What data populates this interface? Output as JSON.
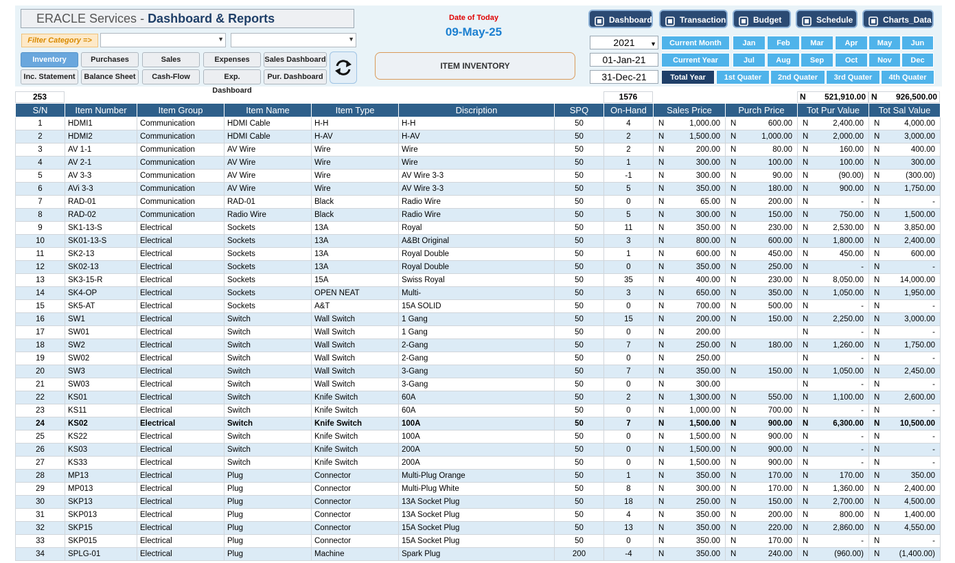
{
  "header": {
    "title_part1": "ERACLE Services",
    "title_sep": " - ",
    "title_part2": "Dashboard & Reports",
    "filter_label": "Filter Category =>",
    "date_label": "Date of Today",
    "date_value": "09-May-25",
    "item_inventory": "ITEM INVENTORY",
    "year": "2021",
    "start_date": "01-Jan-21",
    "end_date": "31-Dec-21"
  },
  "nav": {
    "row1": [
      "Inventory",
      "Purchases",
      "Sales",
      "Expenses",
      "Sales Dashboard"
    ],
    "row2": [
      "Inc. Statement",
      "Balance Sheet",
      "Cash-Flow",
      "Exp. Dashboard",
      "Pur. Dashboard"
    ]
  },
  "top_buttons": [
    "Dashboard",
    "Transaction",
    "Budget",
    "Schedule",
    "Charts_Data"
  ],
  "periods": {
    "row1": [
      "Current Month",
      "Jan",
      "Feb",
      "Mar",
      "Apr",
      "May",
      "Jun"
    ],
    "row2": [
      "Current Year",
      "Jul",
      "Aug",
      "Sep",
      "Oct",
      "Nov",
      "Dec"
    ],
    "row3": [
      "Total Year",
      "1st Quater",
      "2nd Quater",
      "3rd Quater",
      "4th Quater"
    ]
  },
  "summary": {
    "count": "253",
    "on_hand_total": "1576",
    "currency": "N",
    "tot_pur": "521,910.00",
    "tot_sal": "926,500.00"
  },
  "columns": [
    "S/N",
    "Item Number",
    "Item Group",
    "Item Name",
    "Item Type",
    "Discription",
    "SPQ",
    "On-Hand",
    "Sales Price",
    "Purch Price",
    "Tot Pur Value",
    "Tot Sal Value"
  ],
  "rows": [
    [
      "1",
      "HDMI1",
      "Communication",
      "HDMI Cable",
      "H-H",
      "H-H",
      "50",
      "4",
      "N",
      "1,000.00",
      "N",
      "600.00",
      "N",
      "2,400.00",
      "N",
      "4,000.00"
    ],
    [
      "2",
      "HDMI2",
      "Communication",
      "HDMI Cable",
      "H-AV",
      "H-AV",
      "50",
      "2",
      "N",
      "1,500.00",
      "N",
      "1,000.00",
      "N",
      "2,000.00",
      "N",
      "3,000.00"
    ],
    [
      "3",
      "AV  1-1",
      "Communication",
      "AV Wire",
      "Wire",
      "Wire",
      "50",
      "2",
      "N",
      "200.00",
      "N",
      "80.00",
      "N",
      "160.00",
      "N",
      "400.00"
    ],
    [
      "4",
      "AV  2-1",
      "Communication",
      "AV Wire",
      "Wire",
      "Wire",
      "50",
      "1",
      "N",
      "300.00",
      "N",
      "100.00",
      "N",
      "100.00",
      "N",
      "300.00"
    ],
    [
      "5",
      "AV  3-3",
      "Communication",
      "AV Wire",
      "Wire",
      "AV Wire 3-3",
      "50",
      "-1",
      "N",
      "300.00",
      "N",
      "90.00",
      "N",
      "(90.00)",
      "N",
      "(300.00)"
    ],
    [
      "6",
      "AVi  3-3",
      "Communication",
      "AV Wire",
      "Wire",
      "AV Wire 3-3",
      "50",
      "5",
      "N",
      "350.00",
      "N",
      "180.00",
      "N",
      "900.00",
      "N",
      "1,750.00"
    ],
    [
      "7",
      "RAD-01",
      "Communication",
      "RAD-01",
      "Black",
      "Radio Wire",
      "50",
      "0",
      "N",
      "65.00",
      "N",
      "200.00",
      "N",
      "-",
      "N",
      "-"
    ],
    [
      "8",
      "RAD-02",
      "Communication",
      "Radio Wire",
      "Black",
      "Radio Wire",
      "50",
      "5",
      "N",
      "300.00",
      "N",
      "150.00",
      "N",
      "750.00",
      "N",
      "1,500.00"
    ],
    [
      "9",
      "SK1-13-S",
      "Electrical",
      "Sockets",
      "13A",
      "Royal",
      "50",
      "11",
      "N",
      "350.00",
      "N",
      "230.00",
      "N",
      "2,530.00",
      "N",
      "3,850.00"
    ],
    [
      "10",
      "SK01-13-S",
      "Electrical",
      "Sockets",
      "13A",
      "A&Bt Original",
      "50",
      "3",
      "N",
      "800.00",
      "N",
      "600.00",
      "N",
      "1,800.00",
      "N",
      "2,400.00"
    ],
    [
      "11",
      "SK2-13",
      "Electrical",
      "Sockets",
      "13A",
      "Royal Double",
      "50",
      "1",
      "N",
      "600.00",
      "N",
      "450.00",
      "N",
      "450.00",
      "N",
      "600.00"
    ],
    [
      "12",
      "SK02-13",
      "Electrical",
      "Sockets",
      "13A",
      "Royal Double",
      "50",
      "0",
      "N",
      "350.00",
      "N",
      "250.00",
      "N",
      "-",
      "N",
      "-"
    ],
    [
      "13",
      "SK3-15-R",
      "Electrical",
      "Sockets",
      "15A",
      "Swiss Royal",
      "50",
      "35",
      "N",
      "400.00",
      "N",
      "230.00",
      "N",
      "8,050.00",
      "N",
      "14,000.00"
    ],
    [
      "14",
      "SK4-OP",
      "Electrical",
      "Sockets",
      "OPEN NEAT",
      "Multi-",
      "50",
      "3",
      "N",
      "650.00",
      "N",
      "350.00",
      "N",
      "1,050.00",
      "N",
      "1,950.00"
    ],
    [
      "15",
      "SK5-AT",
      "Electrical",
      "Sockets",
      "A&T",
      "15A    SOLID",
      "50",
      "0",
      "N",
      "700.00",
      "N",
      "500.00",
      "N",
      "-",
      "N",
      "-"
    ],
    [
      "16",
      "SW1",
      "Electrical",
      "Switch",
      "Wall Switch",
      "1 Gang",
      "50",
      "15",
      "N",
      "200.00",
      "N",
      "150.00",
      "N",
      "2,250.00",
      "N",
      "3,000.00"
    ],
    [
      "17",
      "SW01",
      "Electrical",
      "Switch",
      "Wall Switch",
      "1 Gang",
      "50",
      "0",
      "N",
      "200.00",
      "",
      "",
      "N",
      "-",
      "N",
      "-"
    ],
    [
      "18",
      "SW2",
      "Electrical",
      "Switch",
      "Wall Switch",
      "2-Gang",
      "50",
      "7",
      "N",
      "250.00",
      "N",
      "180.00",
      "N",
      "1,260.00",
      "N",
      "1,750.00"
    ],
    [
      "19",
      "SW02",
      "Electrical",
      "Switch",
      "Wall Switch",
      "2-Gang",
      "50",
      "0",
      "N",
      "250.00",
      "",
      "",
      "N",
      "-",
      "N",
      "-"
    ],
    [
      "20",
      "SW3",
      "Electrical",
      "Switch",
      "Wall Switch",
      "3-Gang",
      "50",
      "7",
      "N",
      "350.00",
      "N",
      "150.00",
      "N",
      "1,050.00",
      "N",
      "2,450.00"
    ],
    [
      "21",
      "SW03",
      "Electrical",
      "Switch",
      "Wall Switch",
      "3-Gang",
      "50",
      "0",
      "N",
      "300.00",
      "",
      "",
      "N",
      "-",
      "N",
      "-"
    ],
    [
      "22",
      "KS01",
      "Electrical",
      "Switch",
      "Knife Switch",
      "60A",
      "50",
      "2",
      "N",
      "1,300.00",
      "N",
      "550.00",
      "N",
      "1,100.00",
      "N",
      "2,600.00"
    ],
    [
      "23",
      "KS11",
      "Electrical",
      "Switch",
      "Knife Switch",
      "60A",
      "50",
      "0",
      "N",
      "1,000.00",
      "N",
      "700.00",
      "N",
      "-",
      "N",
      "-"
    ],
    [
      "24",
      "KS02",
      "Electrical",
      "Switch",
      "Knife Switch",
      "100A",
      "50",
      "7",
      "N",
      "1,500.00",
      "N",
      "900.00",
      "N",
      "6,300.00",
      "N",
      "10,500.00"
    ],
    [
      "25",
      "KS22",
      "Electrical",
      "Switch",
      "Knife Switch",
      "100A",
      "50",
      "0",
      "N",
      "1,500.00",
      "N",
      "900.00",
      "N",
      "-",
      "N",
      "-"
    ],
    [
      "26",
      "KS03",
      "Electrical",
      "Switch",
      "Knife Switch",
      "200A",
      "50",
      "0",
      "N",
      "1,500.00",
      "N",
      "900.00",
      "N",
      "-",
      "N",
      "-"
    ],
    [
      "27",
      "KS33",
      "Electrical",
      "Switch",
      "Knife Switch",
      "200A",
      "50",
      "0",
      "N",
      "1,500.00",
      "N",
      "900.00",
      "N",
      "-",
      "N",
      "-"
    ],
    [
      "28",
      "MP13",
      "Electrical",
      "Plug",
      "Connector",
      "Multi-Plug Orange",
      "50",
      "1",
      "N",
      "350.00",
      "N",
      "170.00",
      "N",
      "170.00",
      "N",
      "350.00"
    ],
    [
      "29",
      "MP013",
      "Electrical",
      "Plug",
      "Connector",
      "Multi-Plug White",
      "50",
      "8",
      "N",
      "300.00",
      "N",
      "170.00",
      "N",
      "1,360.00",
      "N",
      "2,400.00"
    ],
    [
      "30",
      "SKP13",
      "Electrical",
      "Plug",
      "Connector",
      "13A Socket Plug",
      "50",
      "18",
      "N",
      "250.00",
      "N",
      "150.00",
      "N",
      "2,700.00",
      "N",
      "4,500.00"
    ],
    [
      "31",
      "SKP013",
      "Electrical",
      "Plug",
      "Connector",
      "13A Socket Plug",
      "50",
      "4",
      "N",
      "350.00",
      "N",
      "200.00",
      "N",
      "800.00",
      "N",
      "1,400.00"
    ],
    [
      "32",
      "SKP15",
      "Electrical",
      "Plug",
      "Connector",
      "15A Socket Plug",
      "50",
      "13",
      "N",
      "350.00",
      "N",
      "220.00",
      "N",
      "2,860.00",
      "N",
      "4,550.00"
    ],
    [
      "33",
      "SKP015",
      "Electrical",
      "Plug",
      "Connector",
      "15A Socket Plug",
      "50",
      "0",
      "N",
      "350.00",
      "N",
      "170.00",
      "N",
      "-",
      "N",
      "-"
    ],
    [
      "34",
      "SPLG-01",
      "Electrical",
      "Plug",
      "Machine",
      "Spark Plug",
      "200",
      "-4",
      "N",
      "350.00",
      "N",
      "240.00",
      "N",
      "(960.00)",
      "N",
      "(1,400.00)"
    ]
  ],
  "bold_row": "24",
  "colors": {
    "header_blue": "#2e5f8a",
    "row_alt": "#dcebf6",
    "nav_active": "#6aa7dd",
    "top_button": "#2b4a73",
    "period_button": "#4fb3ea",
    "date_label": "#e00000",
    "date_value": "#1b7fd0"
  }
}
